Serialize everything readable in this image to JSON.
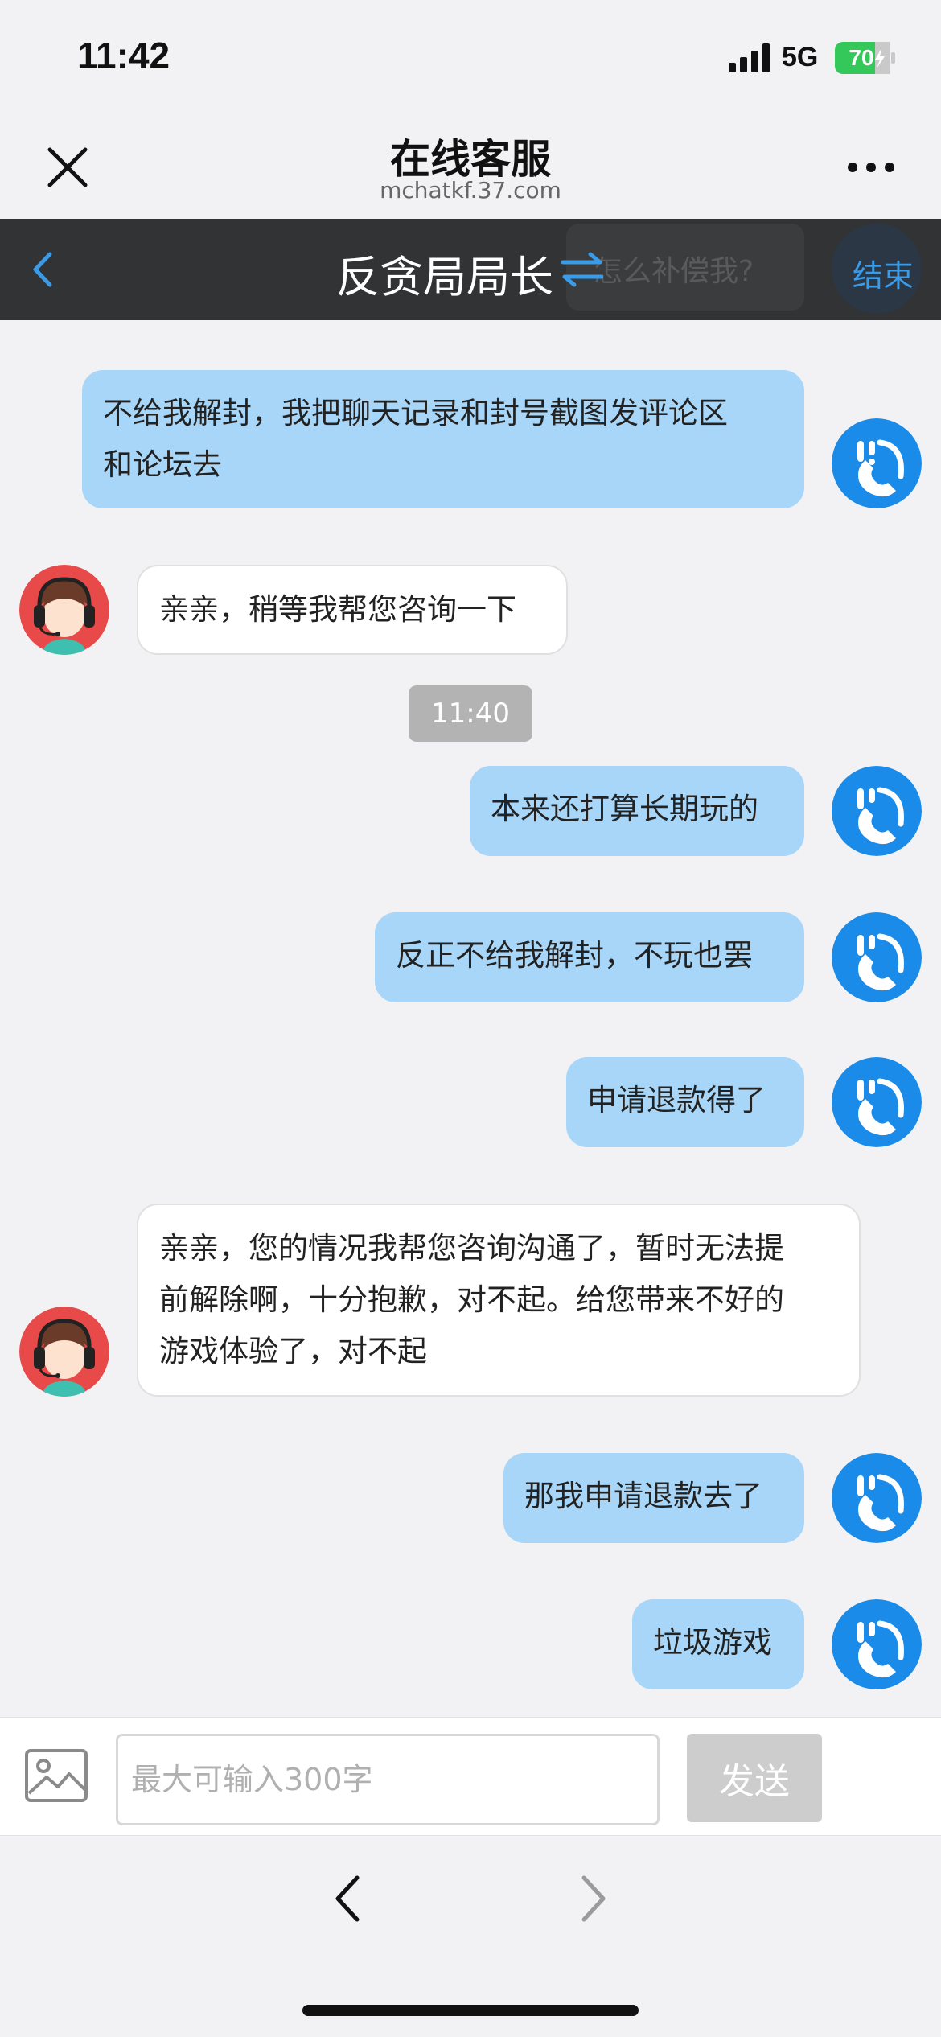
{
  "status_bar": {
    "time": "11:42",
    "network": "5G",
    "battery": "70",
    "battery_color": "#34c759",
    "icons": [
      "signal-icon",
      "battery-icon"
    ]
  },
  "browser": {
    "title": "在线客服",
    "url": "mchatkf.37.com",
    "icons": [
      "close-icon",
      "more-icon"
    ]
  },
  "chat_header": {
    "title": "反贪局局长",
    "floating_message": "怎么补偿我?",
    "end_label": "结束",
    "background": "#323334",
    "accent": "#3b9be6",
    "icons": [
      "back-icon",
      "switch-icon"
    ]
  },
  "messages": [
    {
      "sender": "user",
      "text_lines": [
        "不给我解封，我把聊天记录和封号截图发评论区",
        "和论坛去"
      ]
    },
    {
      "sender": "agent",
      "text_lines": [
        "亲亲，稍等我帮您咨询一下"
      ]
    },
    {
      "sender": "system",
      "text_lines": [
        "11:40"
      ]
    },
    {
      "sender": "user",
      "text_lines": [
        "本来还打算长期玩的"
      ]
    },
    {
      "sender": "user",
      "text_lines": [
        "反正不给我解封，不玩也罢"
      ]
    },
    {
      "sender": "user",
      "text_lines": [
        "申请退款得了"
      ]
    },
    {
      "sender": "agent",
      "text_lines": [
        "亲亲，您的情况我帮您咨询沟通了，暂时无法提",
        "前解除啊，十分抱歉，对不起。给您带来不好的",
        "游戏体验了，对不起"
      ]
    },
    {
      "sender": "user",
      "text_lines": [
        "那我申请退款去了"
      ]
    },
    {
      "sender": "user",
      "text_lines": [
        "垃圾游戏"
      ]
    }
  ],
  "bubble_colors": {
    "user": "#a8d6f8",
    "agent": "#ffffff"
  },
  "input": {
    "placeholder": "最大可输入300字",
    "value": "",
    "send_label": "发送",
    "icons": [
      "image-icon"
    ]
  },
  "bottom_nav": {
    "icons": [
      "nav-back-icon",
      "nav-forward-icon"
    ]
  }
}
